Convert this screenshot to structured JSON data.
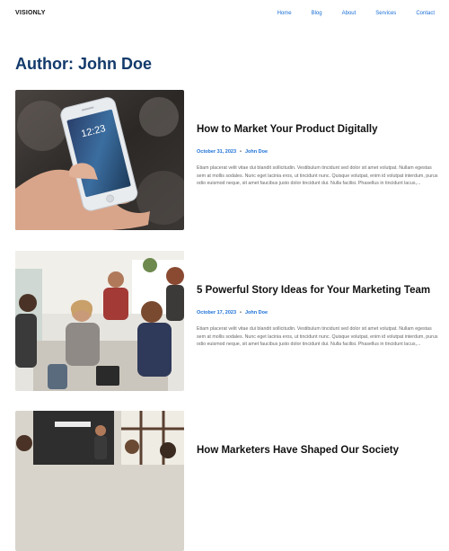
{
  "site": {
    "logo": "VISIONLY"
  },
  "nav": [
    "Home",
    "Blog",
    "About",
    "Services",
    "Contact"
  ],
  "page_title": "Author: John Doe",
  "posts": [
    {
      "title": "How to Market Your Product Digitally",
      "date": "October 31, 2023",
      "author": "John Doe",
      "excerpt": "Etiam placerat velit vitae dui blandit sollicitudin. Vestibulum tincidunt sed dolor sit amet volutpat. Nullam egestas sem at mollis sodales. Nunc eget lacinia eros, ut tincidunt nunc. Quisque volutpat, enim id volutpat interdum, purus odio euismod neque, sit amet faucibus justo dolor tincidunt dui. Nulla facilisi. Phasellus in tincidunt lacus,...",
      "image_icon": "phone-in-hand-photo"
    },
    {
      "title": "5 Powerful Story Ideas for Your Marketing Team",
      "date": "October 17, 2023",
      "author": "John Doe",
      "excerpt": "Etiam placerat velit vitae dui blandit sollicitudin. Vestibulum tincidunt sed dolor sit amet volutpat. Nullam egestas sem at mollis sodales. Nunc eget lacinia eros, ut tincidunt nunc. Quisque volutpat, enim id volutpat interdum, purus odio euismod neque, sit amet faucibus justo dolor tincidunt dui. Nulla facilisi. Phasellus in tincidunt lacus,...",
      "image_icon": "team-meeting-photo"
    },
    {
      "title": "How Marketers Have Shaped Our Society",
      "image_icon": "presentation-photo"
    }
  ],
  "colors": {
    "accent": "#1a6fd6",
    "title": "#123a6b"
  }
}
